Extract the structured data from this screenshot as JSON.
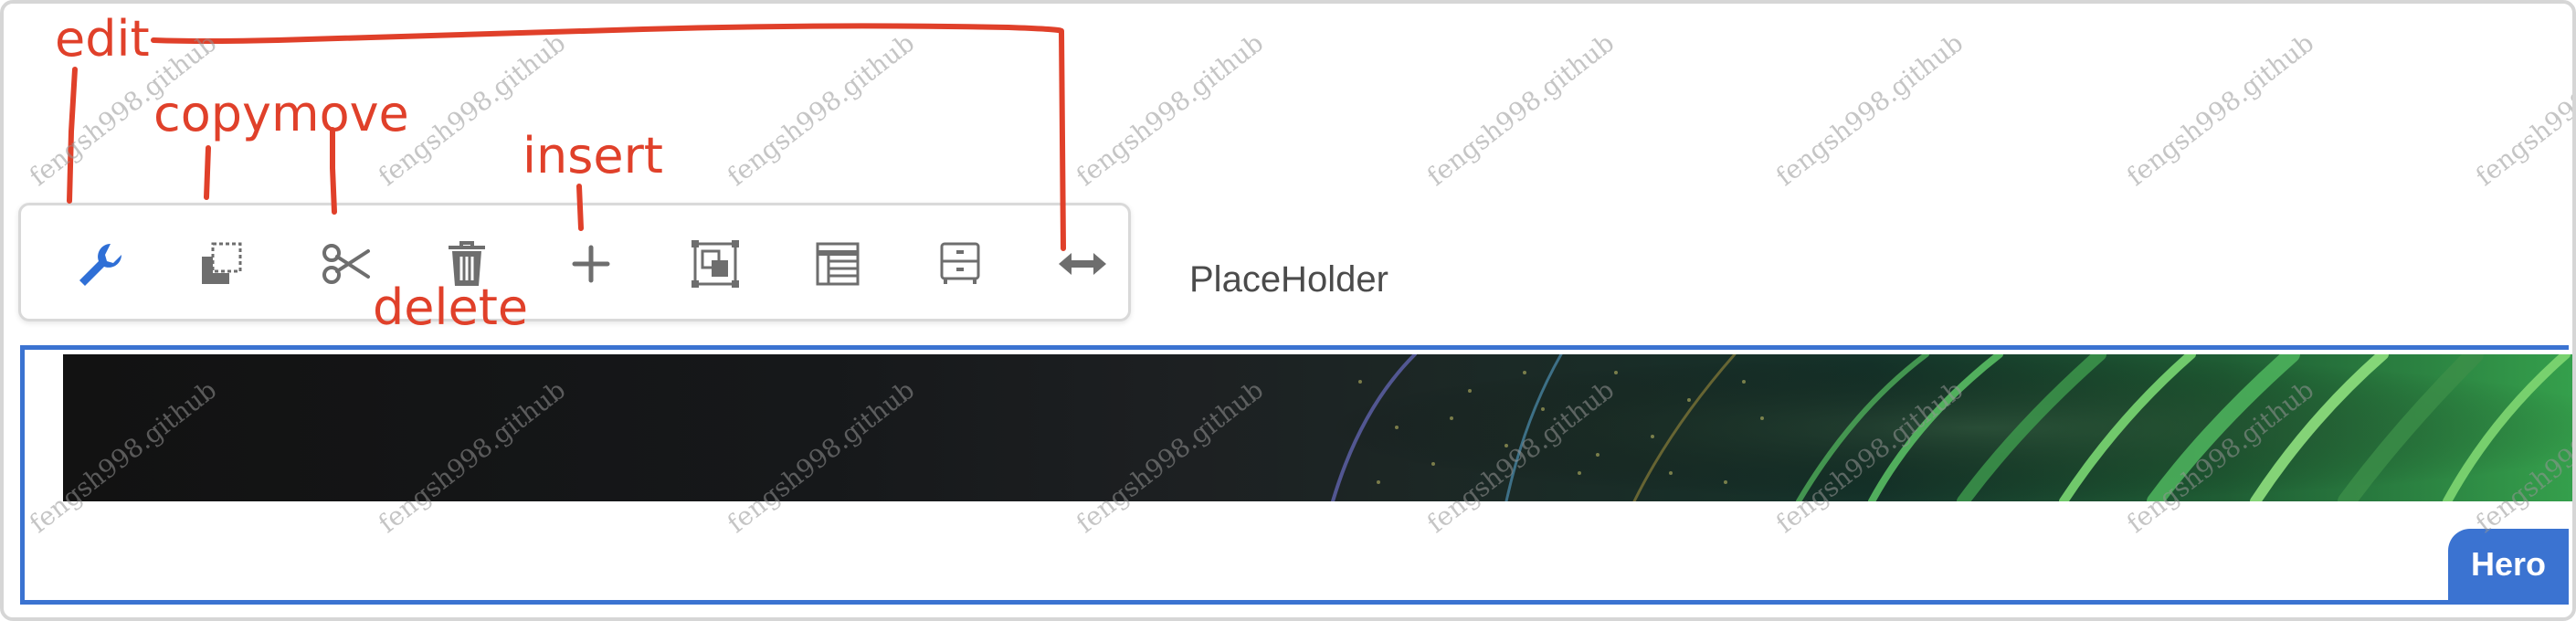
{
  "toolbar": {
    "tools": [
      {
        "name": "edit",
        "icon": "wrench-icon",
        "color": "#2f6fd6"
      },
      {
        "name": "copy",
        "icon": "copy-icon",
        "color": "#6e6e6e"
      },
      {
        "name": "move",
        "icon": "scissors-icon",
        "color": "#6e6e6e"
      },
      {
        "name": "delete",
        "icon": "trash-icon",
        "color": "#6e6e6e"
      },
      {
        "name": "insert",
        "icon": "plus-icon",
        "color": "#6e6e6e"
      },
      {
        "name": "group",
        "icon": "group-icon",
        "color": "#6e6e6e"
      },
      {
        "name": "table",
        "icon": "table-icon",
        "color": "#6e6e6e"
      },
      {
        "name": "cabinet",
        "icon": "cabinet-icon",
        "color": "#6e6e6e"
      },
      {
        "name": "resize",
        "icon": "arrows-horizontal-icon",
        "color": "#6e6e6e"
      }
    ]
  },
  "placeholder": {
    "text": "PlaceHolder"
  },
  "hero": {
    "badge_label": "Hero",
    "accent_color": "#3b73d1"
  },
  "annotations": {
    "color": "#e0402a",
    "labels": {
      "edit": "edit",
      "copymove": "copymove",
      "insert": "insert",
      "delete": "delete"
    }
  },
  "watermark": {
    "text": "fengsh998.github"
  }
}
